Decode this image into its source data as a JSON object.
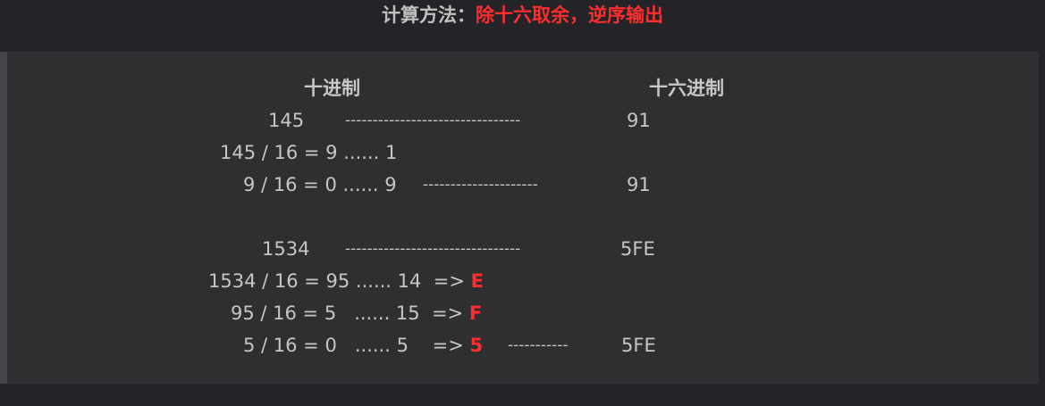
{
  "heading": {
    "label": "计算方法：",
    "method": "除十六取余，逆序输出"
  },
  "columns": {
    "decimal": "十进制",
    "hex": "十六进制"
  },
  "example1": {
    "number": "145",
    "dashes_long": "--------------------------------",
    "result_top": "91",
    "step1": "145 / 16 = 9 ...... 1",
    "step2": "9 / 16 = 0 ...... 9",
    "dashes_mid": "---------------------",
    "result_bottom": "91"
  },
  "example2": {
    "number": "1534",
    "dashes_long": "--------------------------------",
    "result_top": "5FE",
    "step1": "1534 / 16 = 95 ...... 14  =>",
    "digit1": "E",
    "step2": "95 / 16 = 5   ...... 15  =>",
    "digit2": "F",
    "step3": "5 / 16 = 0   ...... 5    =>",
    "digit3": "5",
    "dashes_short": "-----------",
    "result_bottom": "5FE"
  }
}
